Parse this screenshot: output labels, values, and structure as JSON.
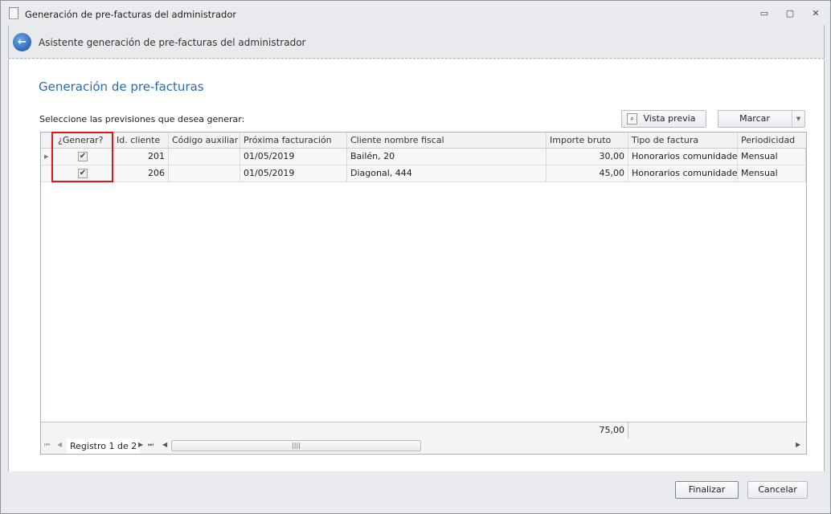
{
  "window": {
    "title": "Generación de pre-facturas del administrador",
    "min": "▭",
    "max": "▢",
    "close": "✕"
  },
  "header": {
    "text": "Asistente generación de pre-facturas del administrador"
  },
  "main": {
    "heading": "Generación de pre-facturas",
    "label": "Seleccione las previsiones que desea generar:",
    "preview_label": "Vista previa",
    "mark_label": "Marcar"
  },
  "grid": {
    "columns": [
      "¿Generar?",
      "Id. cliente",
      "Código auxiliar",
      "Próxima facturación",
      "Cliente nombre fiscal",
      "Importe bruto",
      "Tipo de factura",
      "Periodicidad"
    ],
    "rows": [
      {
        "generar": true,
        "id": "201",
        "codigo": "",
        "fecha": "01/05/2019",
        "cliente": "Bailén, 20",
        "importe": "30,00",
        "tipo": "Honorarios comunidades",
        "periodicidad": "Mensual"
      },
      {
        "generar": true,
        "id": "206",
        "codigo": "",
        "fecha": "01/05/2019",
        "cliente": "Diagonal, 444",
        "importe": "45,00",
        "tipo": "Honorarios comunidades",
        "periodicidad": "Mensual"
      }
    ],
    "total": "75,00",
    "record": "Registro 1 de 2"
  },
  "footer": {
    "finish": "Finalizar",
    "cancel": "Cancelar"
  }
}
